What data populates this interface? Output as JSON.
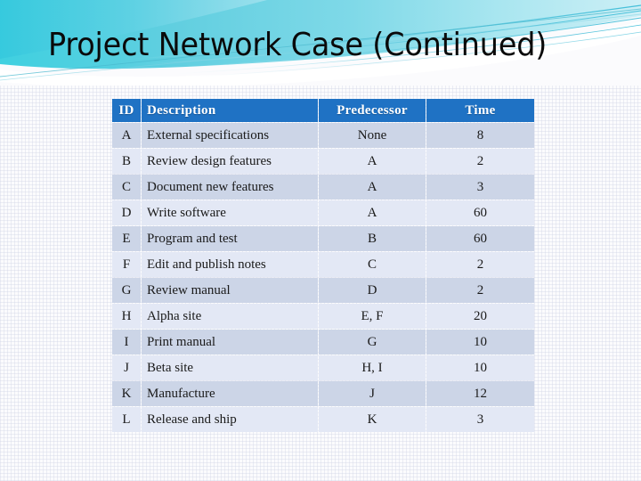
{
  "slide": {
    "title": "Project Network Case (Continued)",
    "theme": {
      "header_cyan": "#5ad3e2",
      "header_blue_deep": "#2ab3cf",
      "table_header_blue": "#1f72c4",
      "row_dark": "#ccd5e7",
      "row_light": "#e3e8f5",
      "title_color": "#0a0a0a",
      "background": "#fbfbfd"
    }
  },
  "table": {
    "columns": [
      "ID",
      "Description",
      "Predecessor",
      "Time"
    ],
    "rows": [
      {
        "id": "A",
        "description": "External specifications",
        "predecessor": "None",
        "time": "8"
      },
      {
        "id": "B",
        "description": "Review design features",
        "predecessor": "A",
        "time": "2"
      },
      {
        "id": "C",
        "description": "Document new features",
        "predecessor": "A",
        "time": "3"
      },
      {
        "id": "D",
        "description": "Write software",
        "predecessor": "A",
        "time": "60"
      },
      {
        "id": "E",
        "description": "Program and test",
        "predecessor": "B",
        "time": "60"
      },
      {
        "id": "F",
        "description": "Edit and publish notes",
        "predecessor": "C",
        "time": "2"
      },
      {
        "id": "G",
        "description": "Review manual",
        "predecessor": "D",
        "time": "2"
      },
      {
        "id": "H",
        "description": "Alpha site",
        "predecessor": "E, F",
        "time": "20"
      },
      {
        "id": "I",
        "description": "Print manual",
        "predecessor": "G",
        "time": "10"
      },
      {
        "id": "J",
        "description": "Beta site",
        "predecessor": "H, I",
        "time": "10"
      },
      {
        "id": "K",
        "description": "Manufacture",
        "predecessor": "J",
        "time": "12"
      },
      {
        "id": "L",
        "description": "Release and ship",
        "predecessor": "K",
        "time": "3"
      }
    ]
  }
}
